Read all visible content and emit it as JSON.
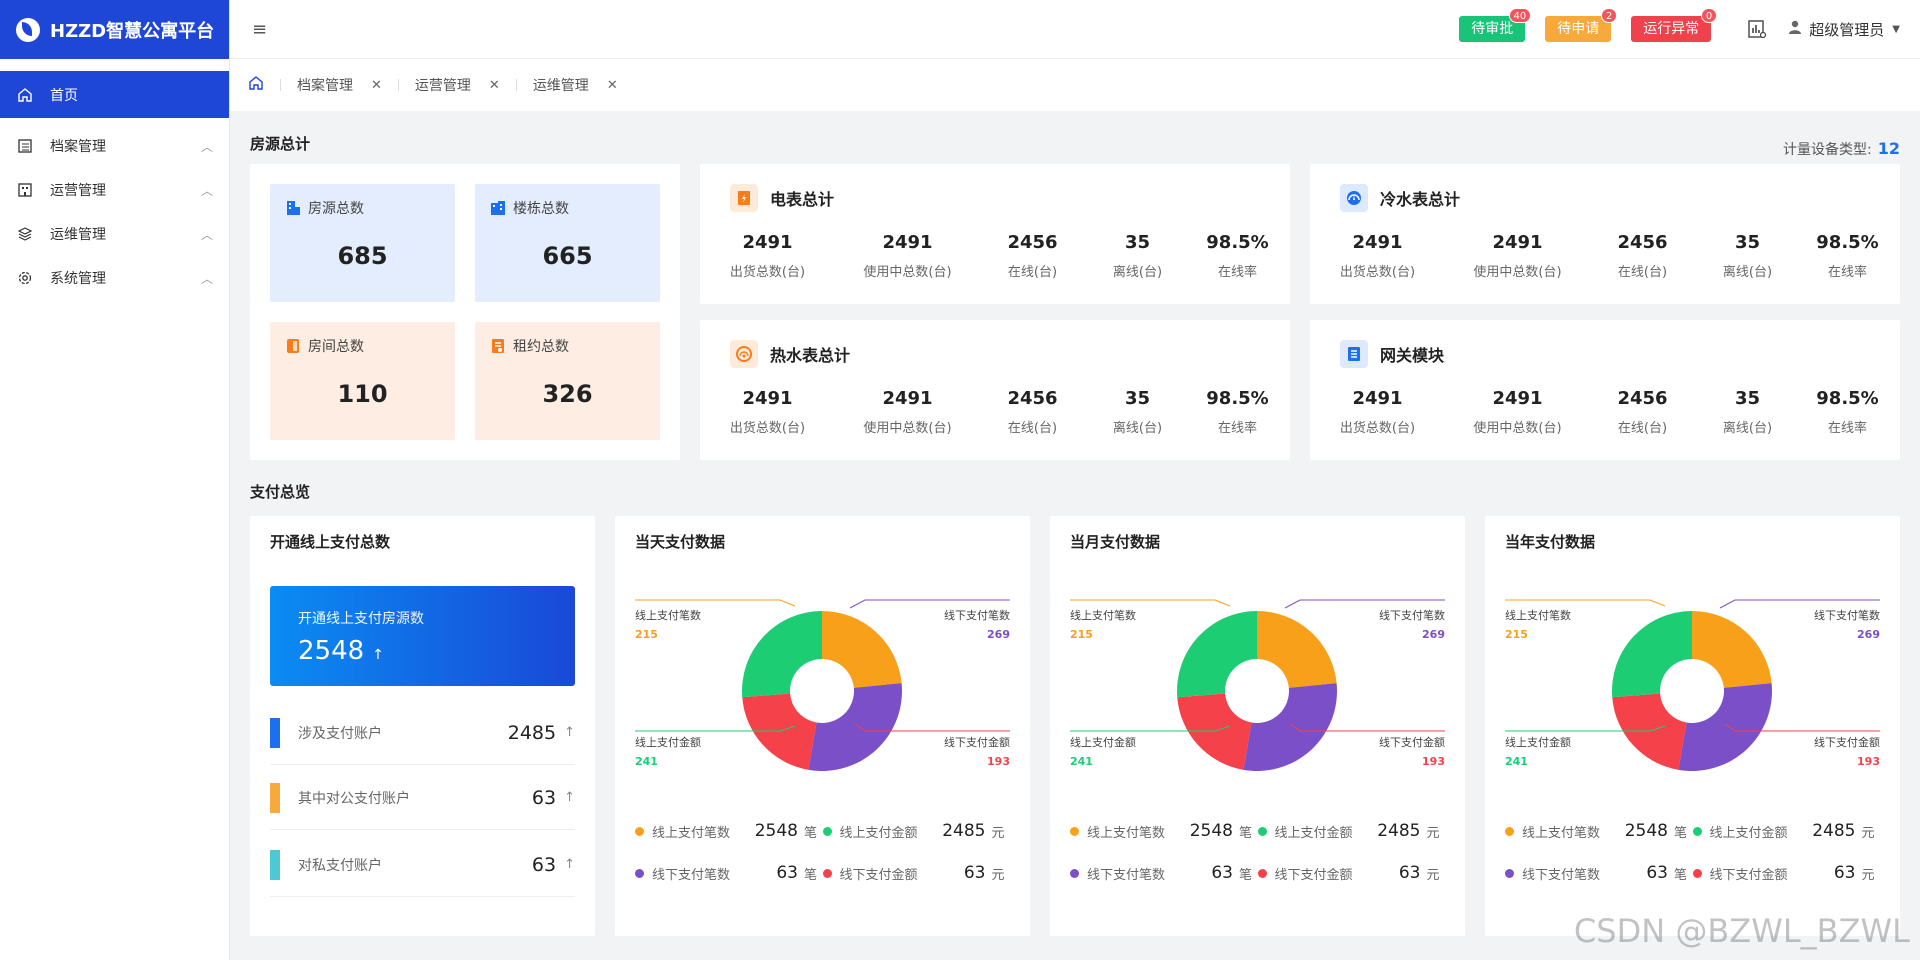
{
  "app": {
    "title": "HZZD智慧公寓平台"
  },
  "sidebar": {
    "items": [
      {
        "label": "首页",
        "icon": "home-icon",
        "active": true
      },
      {
        "label": "档案管理",
        "icon": "archive-icon"
      },
      {
        "label": "运营管理",
        "icon": "building-icon"
      },
      {
        "label": "运维管理",
        "icon": "layers-icon"
      },
      {
        "label": "系统管理",
        "icon": "gear-icon"
      }
    ]
  },
  "header": {
    "pills": [
      {
        "label": "待审批",
        "badge": "40",
        "color": "#19c479"
      },
      {
        "label": "待申请",
        "badge": "2",
        "color": "#f7a93b"
      },
      {
        "label": "运行异常",
        "badge": "0",
        "color": "#f0424d"
      }
    ],
    "user": "超级管理员"
  },
  "tabs": [
    "档案管理",
    "运营管理",
    "运维管理"
  ],
  "housing": {
    "section_title": "房源总计",
    "device_type_label": "计量设备类型:",
    "device_type_count": "12",
    "stats": [
      {
        "label": "房源总数",
        "value": "685"
      },
      {
        "label": "楼栋总数",
        "value": "665"
      },
      {
        "label": "房间总数",
        "value": "110"
      },
      {
        "label": "租约总数",
        "value": "326"
      }
    ],
    "meters": [
      {
        "title": "电表总计",
        "values": [
          "2491",
          "2491",
          "2456",
          "35",
          "98.5%"
        ]
      },
      {
        "title": "冷水表总计",
        "values": [
          "2491",
          "2491",
          "2456",
          "35",
          "98.5%"
        ]
      },
      {
        "title": "热水表总计",
        "values": [
          "2491",
          "2491",
          "2456",
          "35",
          "98.5%"
        ]
      },
      {
        "title": "网关模块",
        "values": [
          "2491",
          "2491",
          "2456",
          "35",
          "98.5%"
        ]
      }
    ],
    "meter_labels": [
      "出货总数(台)",
      "使用中总数(台)",
      "在线(台)",
      "离线(台)",
      "在线率"
    ]
  },
  "payment": {
    "section_title": "支付总览",
    "online": {
      "title": "开通线上支付总数",
      "panel_label": "开通线上支付房源数",
      "panel_value": "2548",
      "panel_arrow": "↑",
      "rows": [
        {
          "label": "涉及支付账户",
          "value": "2485",
          "arrow": "↑",
          "color": "#1e6ef0"
        },
        {
          "label": "其中对公支付账户",
          "value": "63",
          "arrow": "↑",
          "color": "#f7a93b"
        },
        {
          "label": "对私支付账户",
          "value": "63",
          "arrow": "↑",
          "color": "#4fc8d6"
        }
      ]
    },
    "charts": [
      {
        "title": "当天支付数据"
      },
      {
        "title": "当月支付数据"
      },
      {
        "title": "当年支付数据"
      }
    ],
    "pie_labels": [
      {
        "label": "线上支付笔数",
        "value": "215",
        "color": "#f9a01b"
      },
      {
        "label": "线下支付笔数",
        "value": "269",
        "color": "#7b4fc8"
      },
      {
        "label": "线上支付金额",
        "value": "241",
        "color": "#1ccd74"
      },
      {
        "label": "线下支付金额",
        "value": "193",
        "color": "#f5424a"
      }
    ],
    "legend": [
      {
        "label": "线上支付笔数",
        "value": "2548",
        "unit": "笔",
        "color": "#f9a01b"
      },
      {
        "label": "线上支付金额",
        "value": "2485",
        "unit": "元",
        "color": "#1ccd74"
      },
      {
        "label": "线下支付笔数",
        "value": "63",
        "unit": "笔",
        "color": "#7b4fc8"
      },
      {
        "label": "线下支付金额",
        "value": "63",
        "unit": "元",
        "color": "#f5424a"
      }
    ]
  },
  "chart_data": [
    {
      "type": "pie",
      "title": "当天支付数据",
      "categories": [
        "线上支付笔数",
        "线下支付笔数",
        "线下支付金额",
        "线上支付金额"
      ],
      "values": [
        215,
        269,
        193,
        241
      ]
    },
    {
      "type": "pie",
      "title": "当月支付数据",
      "categories": [
        "线上支付笔数",
        "线下支付笔数",
        "线下支付金额",
        "线上支付金额"
      ],
      "values": [
        215,
        269,
        193,
        241
      ]
    },
    {
      "type": "pie",
      "title": "当年支付数据",
      "categories": [
        "线上支付笔数",
        "线下支付笔数",
        "线下支付金额",
        "线上支付金额"
      ],
      "values": [
        215,
        269,
        193,
        241
      ]
    }
  ],
  "watermark": "CSDN @BZWL_BZWL"
}
